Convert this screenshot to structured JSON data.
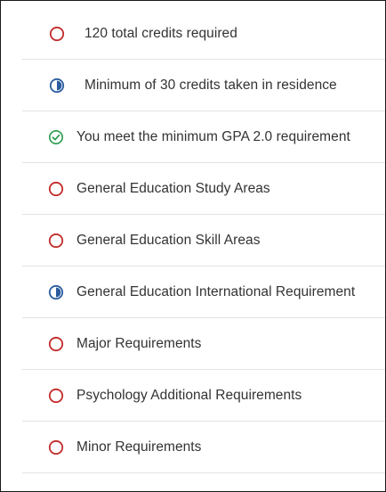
{
  "colors": {
    "not_met": "#c22b2b",
    "in_progress": "#2a5c9e",
    "met": "#2b9a4a",
    "text": "#333333",
    "divider": "#e3e3e3"
  },
  "requirements": [
    {
      "label": "120 total credits required",
      "status": "not-met",
      "icon": "empty-circle-icon"
    },
    {
      "label": "Minimum of 30 credits taken in residence",
      "status": "in-progress",
      "icon": "half-circle-icon"
    },
    {
      "label": "You meet the minimum GPA 2.0 requirement",
      "status": "met",
      "icon": "check-circle-icon"
    },
    {
      "label": "General Education Study Areas",
      "status": "not-met",
      "icon": "empty-circle-icon"
    },
    {
      "label": "General Education Skill Areas",
      "status": "not-met",
      "icon": "empty-circle-icon"
    },
    {
      "label": "General Education International Requirement",
      "status": "in-progress",
      "icon": "half-circle-icon"
    },
    {
      "label": "Major Requirements",
      "status": "not-met",
      "icon": "empty-circle-icon"
    },
    {
      "label": "Psychology Additional Requirements",
      "status": "not-met",
      "icon": "empty-circle-icon"
    },
    {
      "label": "Minor Requirements",
      "status": "not-met",
      "icon": "empty-circle-icon"
    }
  ]
}
